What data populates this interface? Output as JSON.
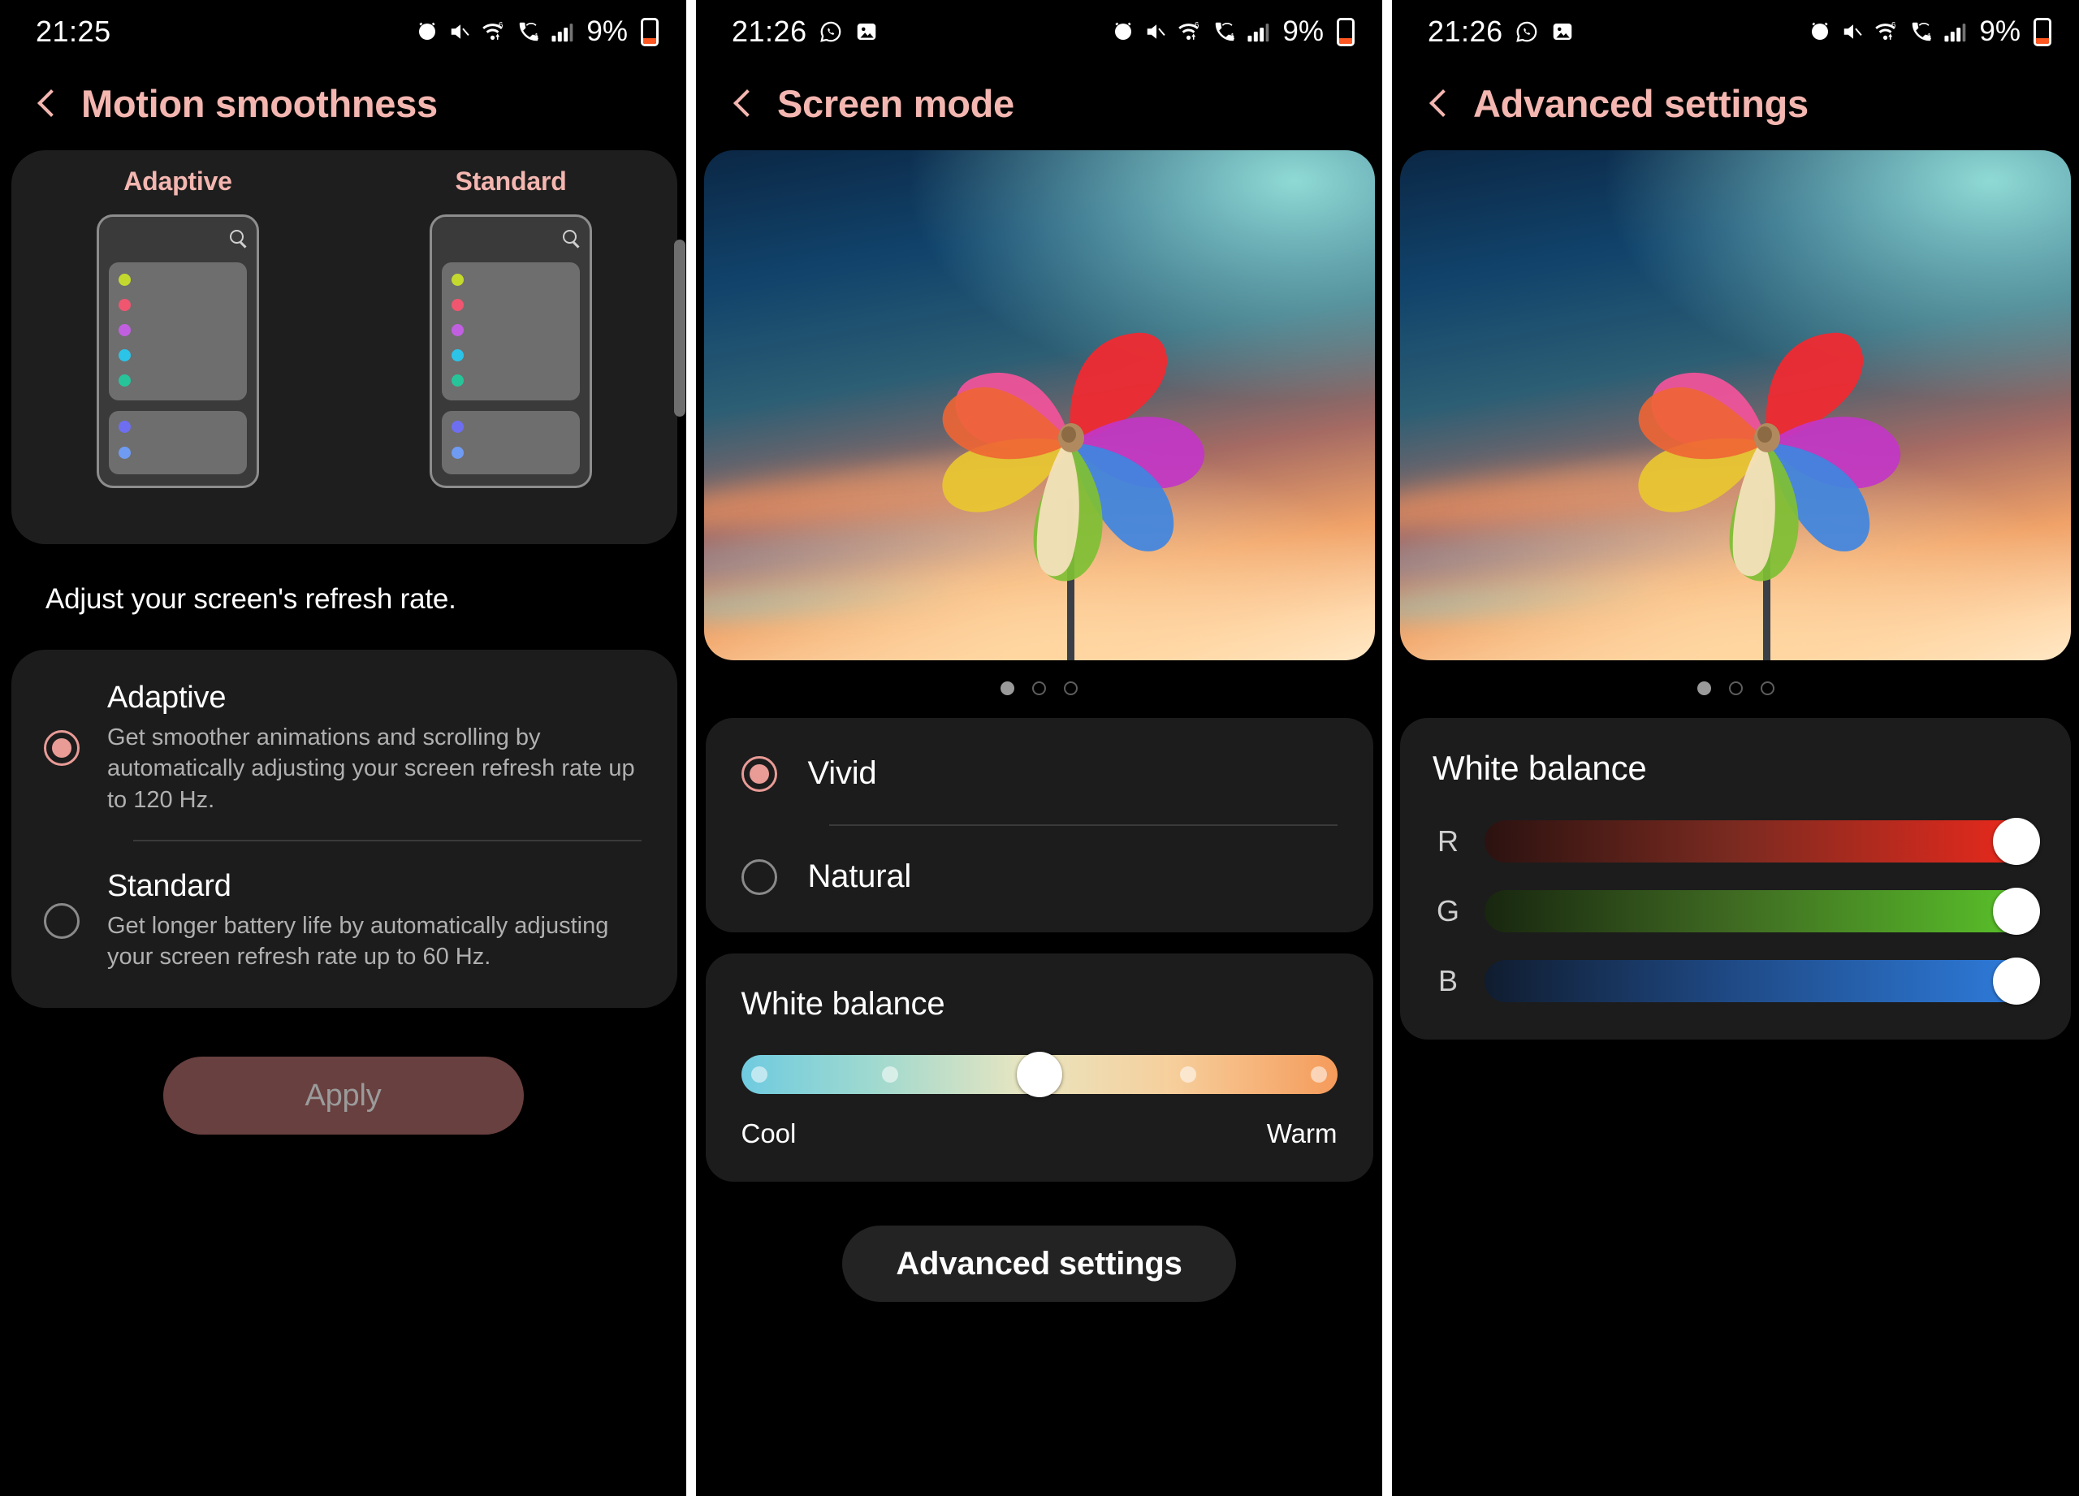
{
  "colors": {
    "accent_pink": "#f4b6b0",
    "radio_selected": "#e99b96",
    "apply_bg": "#68403f",
    "card_bg": "#1c1c1c",
    "screen_bg": "#000000",
    "battery": "#ff5722"
  },
  "panel1": {
    "status": {
      "time": "21:25",
      "battery_percent": "9%",
      "icons": [
        "alarm-icon",
        "mute-icon",
        "wifi6-icon",
        "wifi-calling-icon",
        "signal-bars-icon",
        "battery-icon"
      ]
    },
    "header": {
      "title": "Motion smoothness",
      "back": "back-icon"
    },
    "preview": {
      "left_label": "Adaptive",
      "right_label": "Standard",
      "dot_colors": [
        "#c4d92e",
        "#f0566f",
        "#c060e0",
        "#2bc4e8",
        "#27c49a"
      ],
      "bottom_dot_colors": [
        "#6e6ef0",
        "#6f9bf2"
      ]
    },
    "description": "Adjust your screen's refresh rate.",
    "options": [
      {
        "title": "Adaptive",
        "subtitle": "Get smoother animations and scrolling by automatically adjusting your screen refresh rate up to 120 Hz.",
        "selected": true
      },
      {
        "title": "Standard",
        "subtitle": "Get longer battery life by automatically adjusting your screen refresh rate up to 60 Hz.",
        "selected": false
      }
    ],
    "apply_label": "Apply"
  },
  "panel2": {
    "status": {
      "time": "21:26",
      "battery_percent": "9%",
      "notification_icons": [
        "whatsapp-icon",
        "gallery-icon"
      ],
      "icons": [
        "alarm-icon",
        "mute-icon",
        "wifi6-icon",
        "wifi-calling-icon",
        "signal-bars-icon",
        "battery-icon"
      ]
    },
    "header": {
      "title": "Screen mode",
      "back": "back-icon"
    },
    "pager": {
      "count": 3,
      "active": 0
    },
    "modes": [
      {
        "label": "Vivid",
        "selected": true
      },
      {
        "label": "Natural",
        "selected": false
      }
    ],
    "white_balance": {
      "title": "White balance",
      "cool_label": "Cool",
      "warm_label": "Warm",
      "value_percent": 50,
      "tick_percents": [
        3,
        25,
        50,
        75,
        97
      ]
    },
    "advanced_label": "Advanced settings"
  },
  "panel3": {
    "status": {
      "time": "21:26",
      "battery_percent": "9%",
      "notification_icons": [
        "whatsapp-icon",
        "gallery-icon"
      ],
      "icons": [
        "alarm-icon",
        "mute-icon",
        "wifi6-icon",
        "wifi-calling-icon",
        "signal-bars-icon",
        "battery-icon"
      ]
    },
    "header": {
      "title": "Advanced settings",
      "back": "back-icon"
    },
    "pager": {
      "count": 3,
      "active": 0
    },
    "white_balance": {
      "title": "White balance",
      "channels": [
        {
          "letter": "R",
          "value_percent": 100
        },
        {
          "letter": "G",
          "value_percent": 100
        },
        {
          "letter": "B",
          "value_percent": 100
        }
      ]
    }
  }
}
